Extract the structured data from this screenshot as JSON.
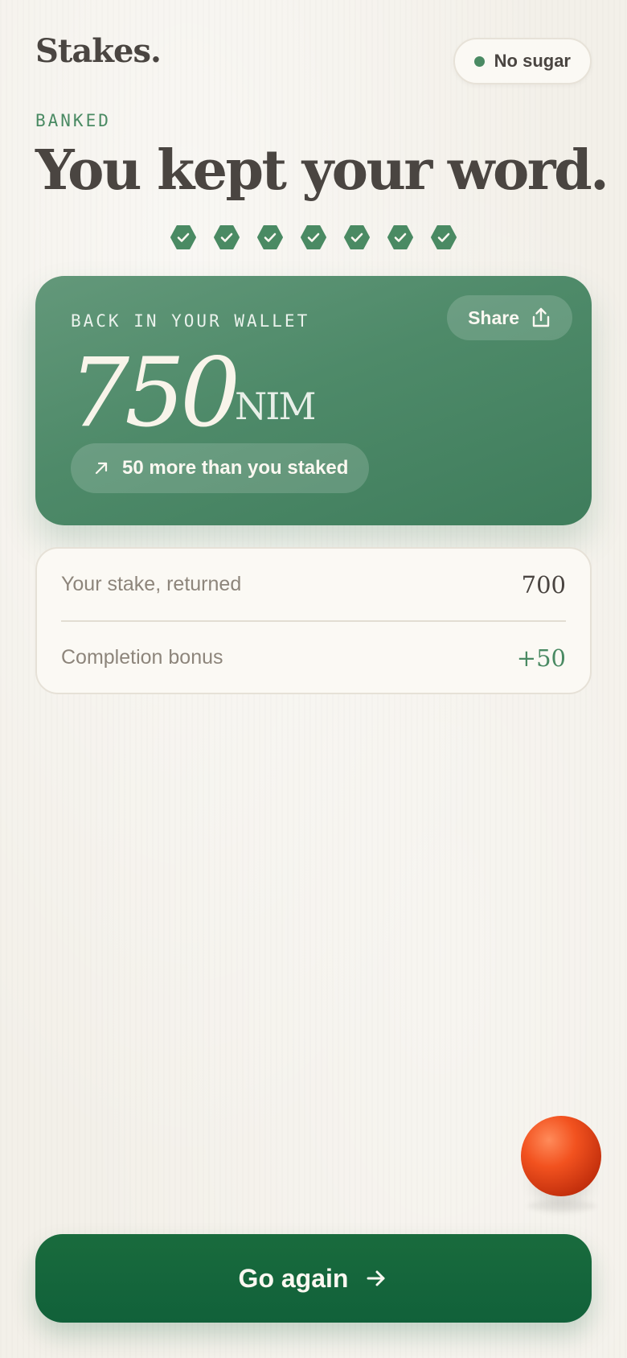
{
  "header": {
    "logo_text": "Stakes.",
    "status_pill": {
      "label": "No sugar",
      "dot_color": "#4a8a63"
    }
  },
  "hero": {
    "eyebrow": "BANKED",
    "headline": "You kept your word.",
    "completed_days": 7
  },
  "wallet_card": {
    "label": "BACK IN YOUR WALLET",
    "share_label": "Share",
    "amount": "750",
    "unit": "NIM",
    "delta_text": "50 more than you staked"
  },
  "breakdown": {
    "rows": [
      {
        "label": "Your stake, returned",
        "value": "700"
      },
      {
        "label": "Completion bonus",
        "value": "+50"
      }
    ]
  },
  "cta": {
    "label": "Go again"
  },
  "colors": {
    "accent_green": "#4a8a63",
    "cta_green": "#11613a",
    "background": "#f3f0e9",
    "ball_orange": "#f2521f"
  },
  "icons": {
    "check": "check-hexagon-icon",
    "share": "share-icon",
    "delta": "arrow-up-right-icon",
    "cta": "arrow-right-icon"
  }
}
